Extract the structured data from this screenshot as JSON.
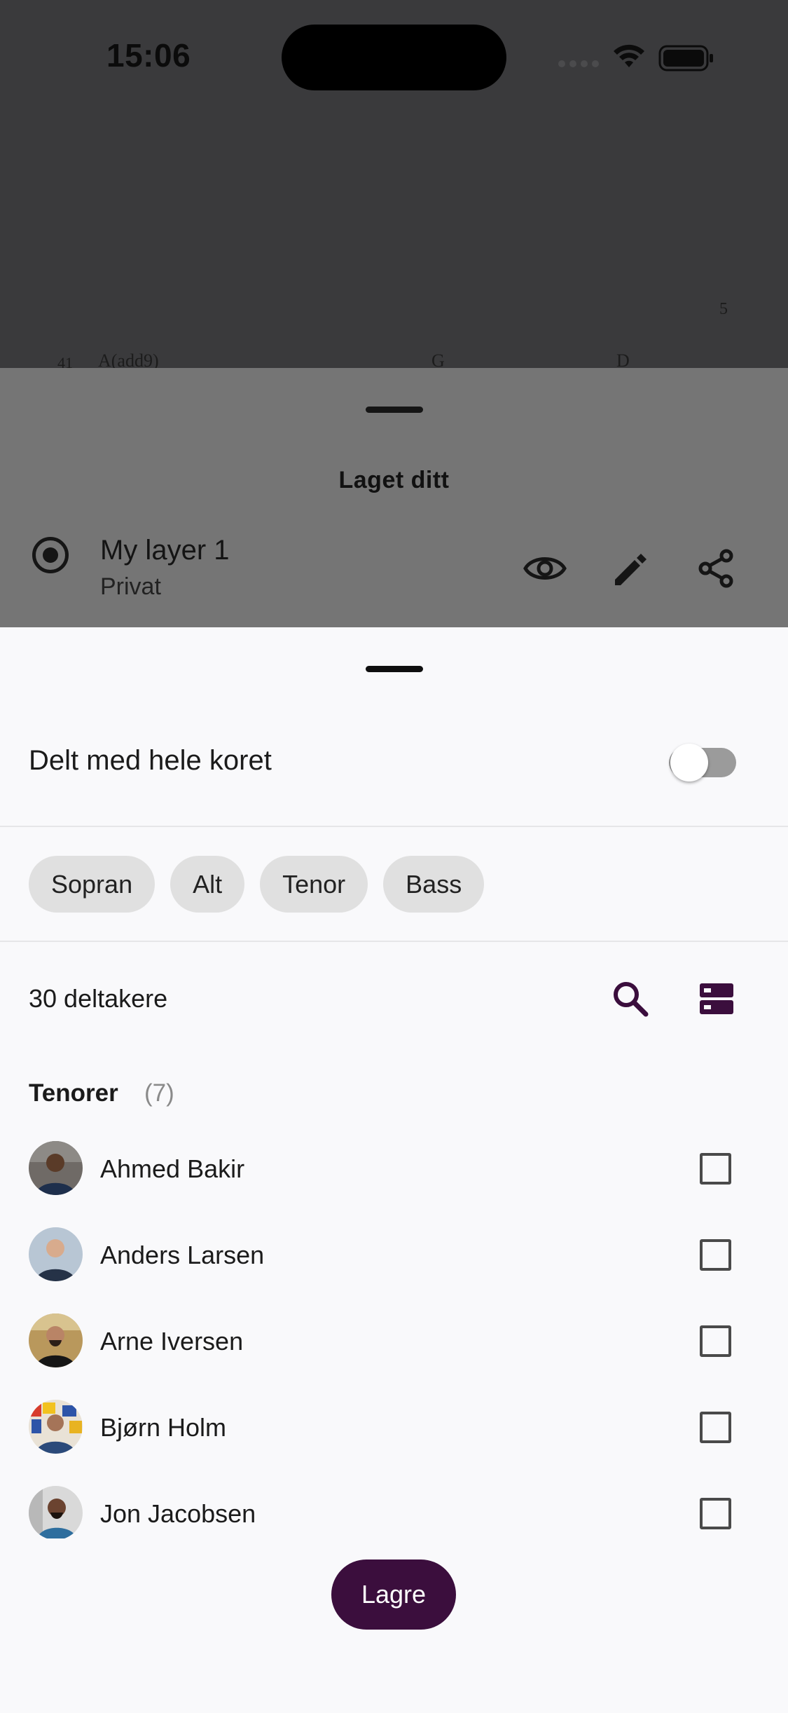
{
  "status_bar": {
    "time": "15:06"
  },
  "score": {
    "page_number": "5",
    "bar_number": "41",
    "chords": [
      "A(add9)",
      "G",
      "D"
    ]
  },
  "layer_panel": {
    "title": "Laget ditt",
    "layer_name": "My layer 1",
    "layer_visibility": "Privat",
    "icons": [
      "radio-selected-icon",
      "eye-icon",
      "pencil-icon",
      "share-icon"
    ]
  },
  "share_sheet": {
    "share_all_label": "Delt med hele koret",
    "share_all_enabled": false,
    "voice_chips": [
      "Sopran",
      "Alt",
      "Tenor",
      "Bass"
    ],
    "participants_count": "30 deltakere",
    "group": {
      "title": "Tenorer",
      "count": "(7)"
    },
    "members": [
      {
        "name": "Ahmed Bakir",
        "checked": false
      },
      {
        "name": "Anders Larsen",
        "checked": false
      },
      {
        "name": "Arne Iversen",
        "checked": false
      },
      {
        "name": "Bjørn Holm",
        "checked": false
      },
      {
        "name": "Jon Jacobsen",
        "checked": false
      }
    ],
    "save_label": "Lagre"
  },
  "colors": {
    "accent": "#3b0e3d",
    "scrim": "#3a3a3c",
    "panel": "#757575",
    "sheet": "#f9f9fb"
  }
}
